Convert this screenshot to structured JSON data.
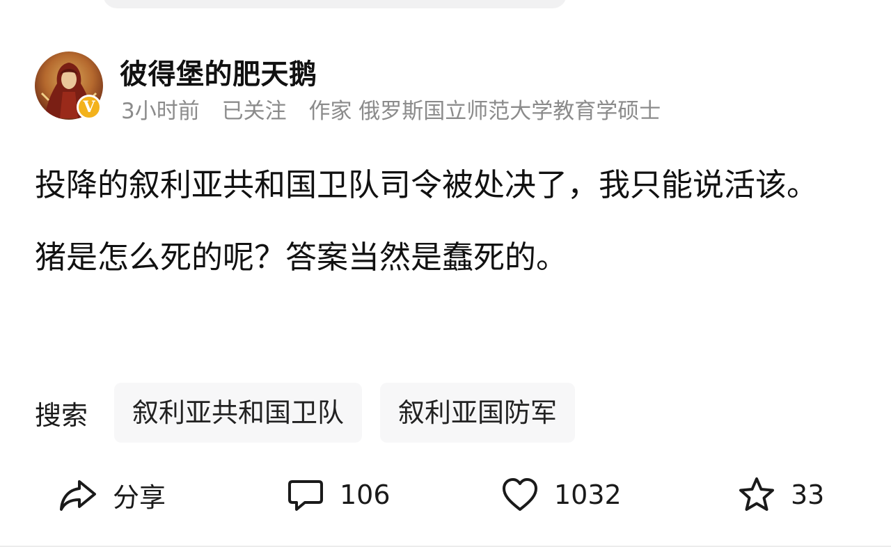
{
  "author": {
    "name": "彼得堡的肥天鹅",
    "badge": "V",
    "meta": [
      "3小时前",
      "已关注",
      "作家 俄罗斯国立师范大学教育学硕士"
    ]
  },
  "post": {
    "paragraphs": [
      "投降的叙利亚共和国卫队司令被处决了，我只能说活该。",
      "猪是怎么死的呢？答案当然是蠢死的。"
    ]
  },
  "search": {
    "label": "搜索",
    "tags": [
      "叙利亚共和国卫队",
      "叙利亚国防军"
    ]
  },
  "actions": {
    "share": {
      "label": "分享",
      "icon": "share-icon"
    },
    "comment": {
      "count": "106",
      "icon": "comment-icon"
    },
    "like": {
      "count": "1032",
      "icon": "heart-icon"
    },
    "favorite": {
      "count": "33",
      "icon": "star-icon"
    }
  },
  "colors": {
    "text": "#111111",
    "meta": "#8b8b8b",
    "tag_bg": "#f7f7f8",
    "badge": "#f3b21c"
  }
}
